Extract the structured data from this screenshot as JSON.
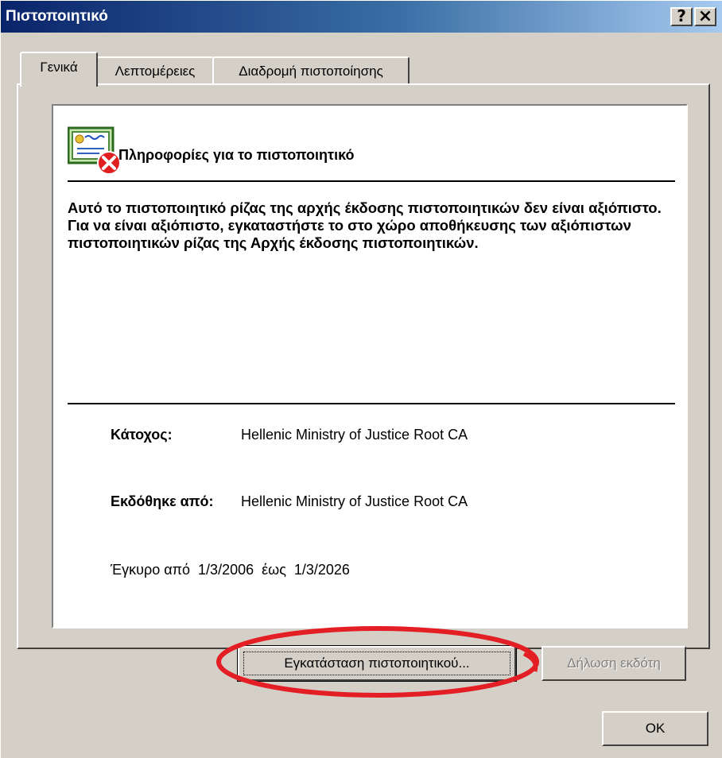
{
  "window": {
    "title": "Πιστοποιητικό",
    "help_glyph": "?",
    "close_glyph": "×"
  },
  "tabs": [
    {
      "label": "Γενικά",
      "active": true
    },
    {
      "label": "Λεπτομέρειες",
      "active": false
    },
    {
      "label": "Διαδρομή πιστοποίησης",
      "active": false
    }
  ],
  "general": {
    "icon": "certificate-error-icon",
    "info_title": "Πληροφορίες για το πιστοποιητικό",
    "warning": "Αυτό το πιστοποιητικό ρίζας της αρχής έκδοσης πιστοποιητικών δεν είναι αξιόπιστο. Για να είναι αξιόπιστο, εγκαταστήστε το στο χώρο αποθήκευσης των αξιόπιστων πιστοποιητικών ρίζας της Αρχής έκδοσης πιστοποιητικών.",
    "issued_to_label": "Κάτοχος:",
    "issued_to_value": "Hellenic Ministry of Justice Root CA",
    "issued_by_label": "Εκδόθηκε από:",
    "issued_by_value": "Hellenic Ministry of Justice Root CA",
    "validity": "Έγκυρο από  1/3/2006  έως  1/3/2026"
  },
  "buttons": {
    "install": "Εγκατάσταση πιστοποιητικού...",
    "issuer_statement": "Δήλωση εκδότη",
    "ok": "OK"
  },
  "colors": {
    "titlebar_start": "#0a246a",
    "titlebar_end": "#a6caf0",
    "dialog_face": "#d4d0c8",
    "annotation_red": "#e31e24"
  }
}
